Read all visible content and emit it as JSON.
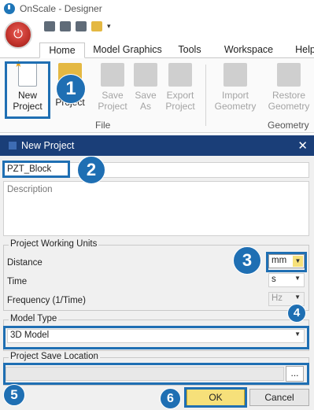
{
  "app": {
    "title": "OnScale - Designer"
  },
  "tabs": [
    "Home",
    "Model Graphics",
    "Tools",
    "Workspace",
    "Help"
  ],
  "ribbon": {
    "buttons": {
      "new_project": "New\nProject",
      "open_project": "Project",
      "save_project": "Save\nProject",
      "save_as": "Save\nAs",
      "export_project": "Export\nProject",
      "import_geometry": "Import\nGeometry",
      "restore_geometry": "Restore\nGeometry"
    },
    "groups": {
      "file": "File",
      "geometry": "Geometry"
    }
  },
  "dialog": {
    "title": "New Project",
    "project_name": "PZT_Block",
    "description_placeholder": "Description",
    "units": {
      "legend": "Project Working Units",
      "distance_label": "Distance",
      "distance_value": "mm",
      "time_label": "Time",
      "time_value": "s",
      "frequency_label": "Frequency (1/Time)",
      "frequency_value": "Hz"
    },
    "model_type": {
      "legend": "Model Type",
      "value": "3D Model"
    },
    "save_location": {
      "legend": "Project Save Location",
      "path": "",
      "browse_label": "..."
    },
    "buttons": {
      "ok": "OK",
      "cancel": "Cancel"
    }
  },
  "annotations": [
    "1",
    "2",
    "3",
    "4",
    "5",
    "6"
  ],
  "colors": {
    "accent": "#1f6fb3",
    "dialog_title": "#1a3e78",
    "ok_button": "#f6e07a"
  }
}
